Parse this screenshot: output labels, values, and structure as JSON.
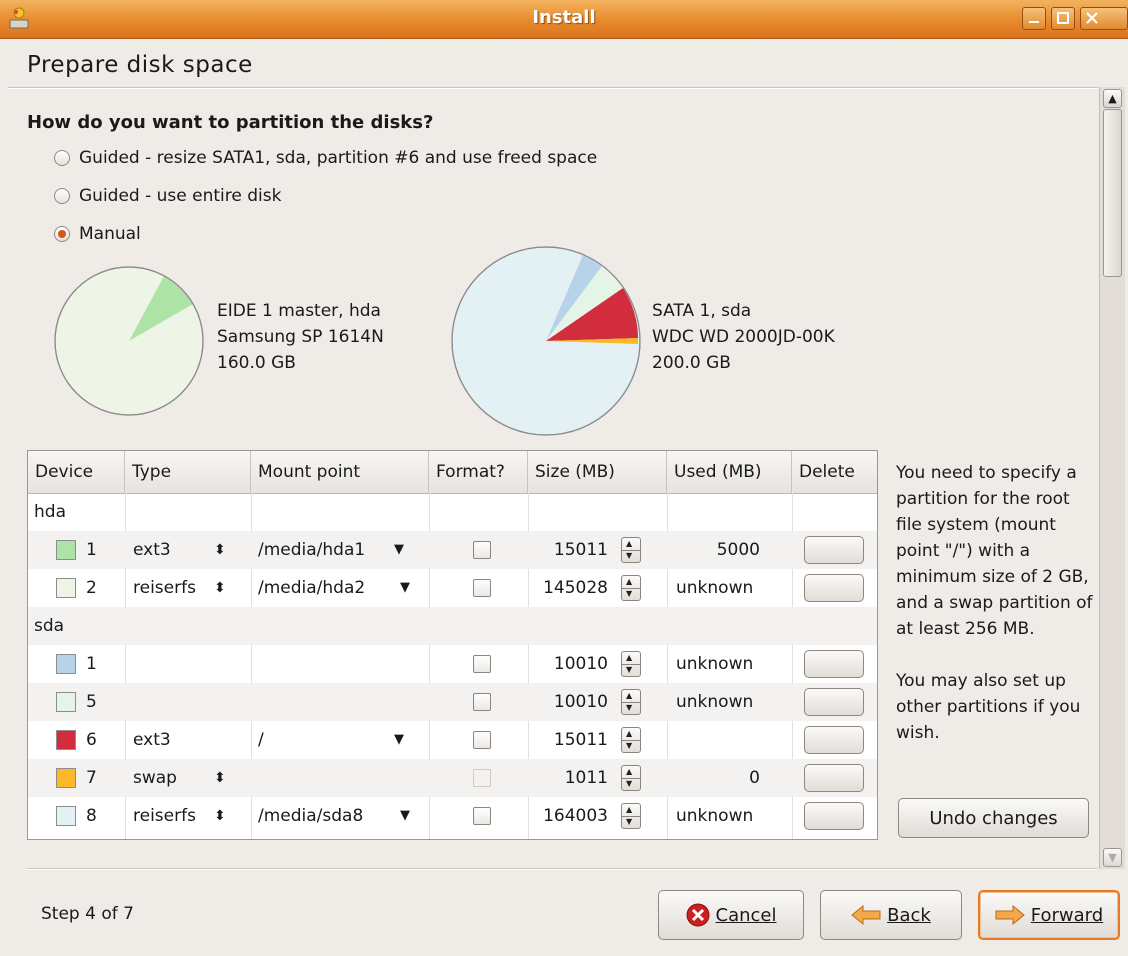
{
  "window": {
    "title": "Install"
  },
  "page_title": "Prepare disk space",
  "question": "How do you want to partition the disks?",
  "options": [
    {
      "label": "Guided - resize SATA1, sda, partition #6 and use freed space",
      "checked": false
    },
    {
      "label": "Guided - use entire disk",
      "checked": false
    },
    {
      "label": "Manual",
      "checked": true
    }
  ],
  "disks": [
    {
      "name": "EIDE 1 master, hda",
      "model": "Samsung SP 1614N",
      "size": "160.0 GB"
    },
    {
      "name": "SATA 1, sda",
      "model": "WDC WD 2000JD-00K",
      "size": "200.0 GB"
    }
  ],
  "table": {
    "headers": [
      "Device",
      "Type",
      "Mount point",
      "Format?",
      "Size (MB)",
      "Used (MB)",
      "Delete"
    ],
    "groups": [
      "hda",
      "sda"
    ],
    "rows": [
      {
        "device": "1",
        "color": "#aee3a8",
        "type": "ext3",
        "mount": "/media/hda1",
        "size": "15011",
        "used": "5000"
      },
      {
        "device": "2",
        "color": "#eef5e6",
        "type": "reiserfs",
        "mount": "/media/hda2",
        "size": "145028",
        "used": "unknown"
      },
      {
        "device": "1",
        "color": "#b7d3e9",
        "type": "",
        "mount": "",
        "size": "10010",
        "used": "unknown"
      },
      {
        "device": "5",
        "color": "#e4f4e6",
        "type": "",
        "mount": "",
        "size": "10010",
        "used": "unknown"
      },
      {
        "device": "6",
        "color": "#d22d3c",
        "type": "ext3",
        "mount": "/",
        "size": "15011",
        "used": ""
      },
      {
        "device": "7",
        "color": "#fbb829",
        "type": "swap",
        "mount": "",
        "size": "1011",
        "used": "0"
      },
      {
        "device": "8",
        "color": "#e3f0f4",
        "type": "reiserfs",
        "mount": "/media/sda8",
        "size": "164003",
        "used": "unknown"
      }
    ]
  },
  "help": {
    "p1": "You need to specify a partition for the root file system (mount point \"/\") with a minimum size of 2 GB, and a swap partition of at least 256 MB.",
    "p2": "You may also set up other partitions if you wish."
  },
  "buttons": {
    "undo": "Undo changes",
    "cancel": "Cancel",
    "back": "Back",
    "forward": "Forward"
  },
  "step": "Step 4 of 7",
  "colors": {
    "titlebar": "#e88b2c",
    "accent": "#d5541b",
    "window_bg": "#efebe7"
  }
}
